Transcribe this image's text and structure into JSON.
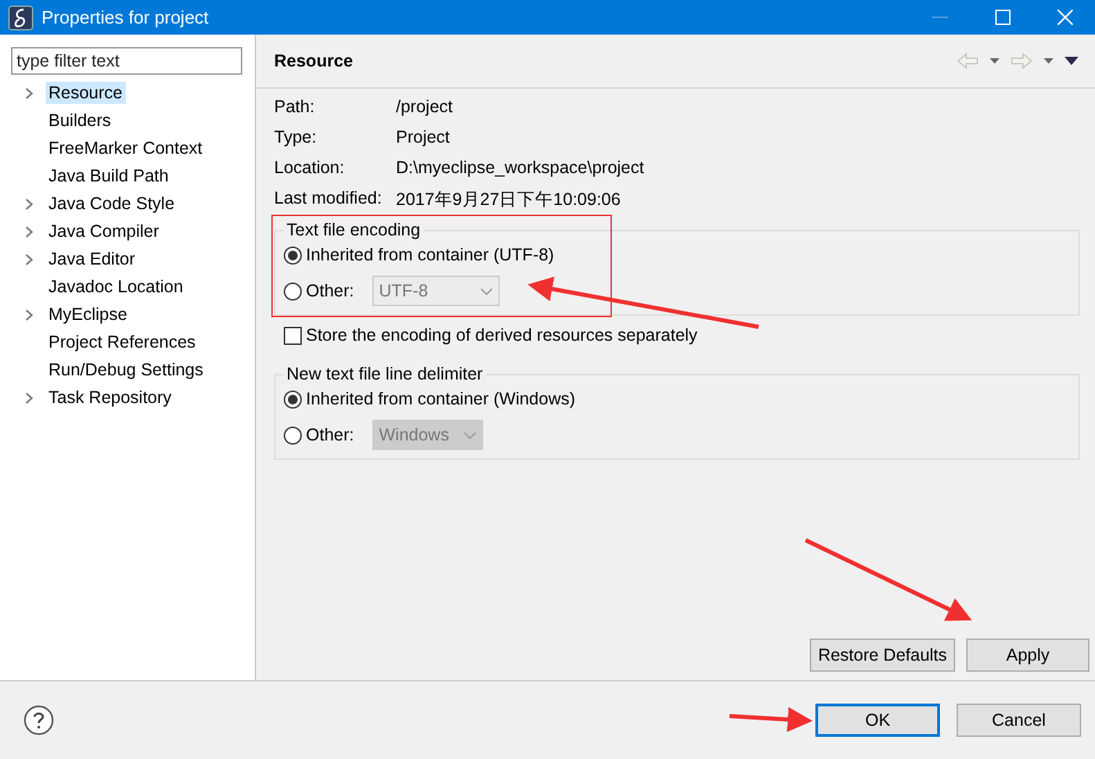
{
  "window": {
    "title": "Properties for project"
  },
  "filter": {
    "placeholder": "type filter text"
  },
  "tree": [
    {
      "label": "Resource",
      "expandable": true,
      "selected": true
    },
    {
      "label": "Builders",
      "expandable": false,
      "selected": false
    },
    {
      "label": "FreeMarker Context",
      "expandable": false,
      "selected": false
    },
    {
      "label": "Java Build Path",
      "expandable": false,
      "selected": false
    },
    {
      "label": "Java Code Style",
      "expandable": true,
      "selected": false
    },
    {
      "label": "Java Compiler",
      "expandable": true,
      "selected": false
    },
    {
      "label": "Java Editor",
      "expandable": true,
      "selected": false
    },
    {
      "label": "Javadoc Location",
      "expandable": false,
      "selected": false
    },
    {
      "label": "MyEclipse",
      "expandable": true,
      "selected": false
    },
    {
      "label": "Project References",
      "expandable": false,
      "selected": false
    },
    {
      "label": "Run/Debug Settings",
      "expandable": false,
      "selected": false
    },
    {
      "label": "Task Repository",
      "expandable": true,
      "selected": false
    }
  ],
  "page": {
    "title": "Resource",
    "info": [
      {
        "label": "Path:",
        "value": "/project"
      },
      {
        "label": "Type:",
        "value": "Project"
      },
      {
        "label": "Location:",
        "value": "D:\\myeclipse_workspace\\project"
      },
      {
        "label": "Last modified:",
        "value": "2017年9月27日下午10:09:06"
      }
    ],
    "groups": [
      {
        "title": "Text file encoding",
        "options": [
          {
            "kind": "radio",
            "label": "Inherited from container (UTF-8)",
            "selected": true
          },
          {
            "kind": "combo",
            "label": "Other:",
            "value": "UTF-8",
            "selected": false
          }
        ]
      },
      {
        "title": "New text file line delimiter",
        "options": [
          {
            "kind": "radio",
            "label": "Inherited from container (Windows)",
            "selected": true
          },
          {
            "kind": "combo",
            "label": "Other:",
            "value": "Windows",
            "selected": false
          }
        ]
      }
    ],
    "store_checkbox": {
      "label": "Store the encoding of derived resources separately",
      "checked": false
    },
    "buttons": [
      "Restore Defaults",
      "Apply"
    ]
  },
  "dialog_buttons": [
    {
      "label": "OK",
      "default": true
    },
    {
      "label": "Cancel",
      "default": false
    }
  ]
}
